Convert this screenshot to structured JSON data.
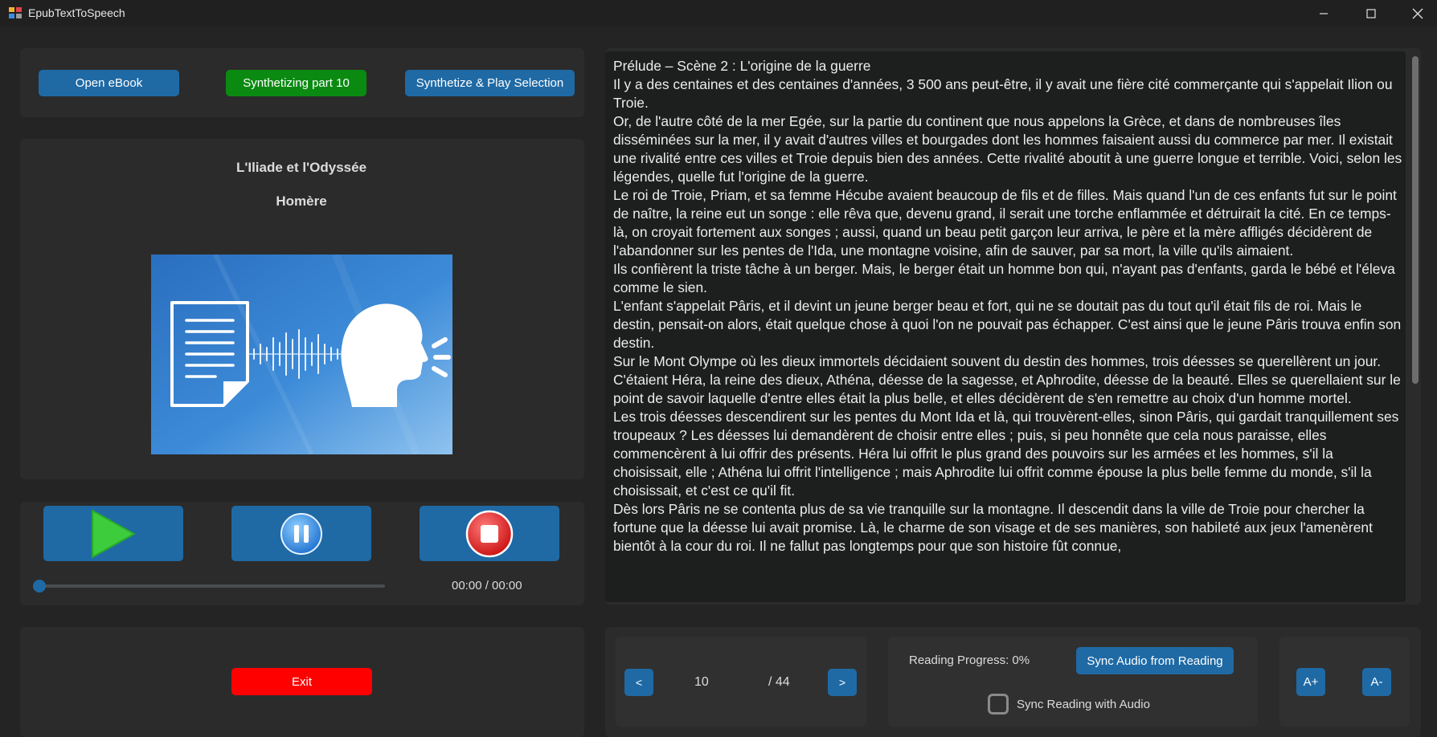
{
  "window": {
    "title": "EpubTextToSpeech",
    "minimize_icon": "minimize-icon",
    "maximize_icon": "maximize-icon",
    "close_icon": "close-icon"
  },
  "toolbar": {
    "open_label": "Open eBook",
    "synth_status_label": "Synthetizing part 10",
    "synth_play_label": "Synthetize & Play Selection"
  },
  "book": {
    "title": "L'Iliade et l'Odyssée",
    "author": "Homère",
    "cover_icon": "text-to-speech-cover-image"
  },
  "player": {
    "play_icon": "play-icon",
    "pause_icon": "pause-icon",
    "stop_icon": "stop-icon",
    "time": "00:00 / 00:00",
    "position_fraction": 0
  },
  "exit_label": "Exit",
  "reader": {
    "paragraphs": [
      "Prélude – Scène 2 : L'origine de la guerre",
      "Il y a des centaines et des centaines d'années, 3 500 ans peut-être, il y avait une fière cité commerçante qui s'appelait Ilion ou Troie.",
      "Or, de l'autre côté de la mer Egée, sur la partie du continent que nous appelons la Grèce, et dans de nombreuses îles disséminées sur la mer, il y avait d'autres villes et bourgades dont les hommes faisaient aussi du commerce par mer. Il existait une rivalité entre ces villes et Troie depuis bien des années. Cette rivalité aboutit à une guerre longue et terrible. Voici, selon les légendes, quelle fut l'origine de la guerre.",
      "Le roi de Troie, Priam, et sa femme Hécube avaient beaucoup de fils et de filles. Mais quand l'un de ces enfants fut sur le point de naître, la reine eut un songe : elle rêva que, devenu grand, il serait une torche enflammée et détruirait la cité. En ce temps-là, on croyait fortement aux songes ; aussi, quand un beau petit garçon leur arriva, le père et la mère affligés décidèrent de l'abandonner sur les pentes de l'Ida, une montagne voisine, afin de sauver, par sa mort, la ville qu'ils aimaient.",
      "Ils confièrent la triste tâche à un berger. Mais, le berger était un homme bon qui, n'ayant pas d'enfants, garda le bébé et l'éleva comme le sien.",
      "L'enfant s'appelait Pâris, et il devint un jeune berger beau et fort, qui ne se doutait pas du tout qu'il était fils de roi. Mais le destin, pensait-on alors, était quelque chose à quoi l'on ne pouvait pas échapper. C'est ainsi que le jeune Pâris trouva enfin son destin.",
      "Sur le Mont Olympe où les dieux immortels décidaient souvent du destin des hommes, trois déesses se querellèrent un jour. C'étaient Héra, la reine des dieux, Athéna, déesse de la sagesse, et Aphrodite, déesse de la beauté. Elles se querellaient sur le point de savoir laquelle d'entre elles était la plus belle, et elles décidèrent de s'en remettre au choix d'un homme mortel.",
      "Les trois déesses descendirent sur les pentes du Mont Ida et là, qui trouvèrent-elles, sinon Pâris, qui gardait tranquillement ses troupeaux ? Les déesses lui demandèrent de choisir entre elles ; puis, si peu honnête que cela nous paraisse, elles commencèrent à lui offrir des présents. Héra lui offrit le plus grand des pouvoirs sur les armées et les hommes, s'il la choisissait, elle ; Athéna lui offrit l'intelligence ; mais Aphrodite lui offrit comme épouse la plus belle femme du monde, s'il la choisissait, et c'est ce qu'il fit.",
      "Dès lors Pâris ne se contenta plus de sa vie tranquille sur la montagne. Il descendit dans la ville de Troie pour chercher la fortune que la déesse lui avait promise. Là, le charme de son visage et de ses manières, son habileté aux jeux l'amenèrent bientôt à la cour du roi. Il ne fallut pas longtemps pour que son histoire fût connue,"
    ]
  },
  "nav": {
    "prev_label": "<",
    "current_page": "10",
    "total_pages": "/ 44",
    "next_label": ">"
  },
  "sync": {
    "progress_text": "Reading Progress: 0%",
    "sync_audio_label": "Sync Audio from Reading",
    "sync_reading_label": "Sync Reading with Audio",
    "sync_reading_checked": false
  },
  "font_size": {
    "increase_label": "A+",
    "decrease_label": "A-"
  }
}
